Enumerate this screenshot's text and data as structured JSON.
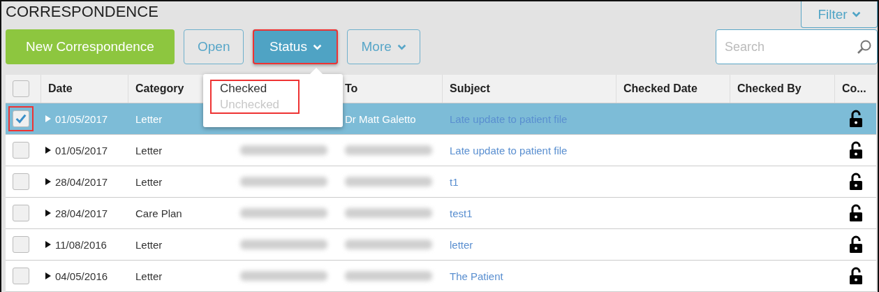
{
  "page": {
    "title": "CORRESPONDENCE"
  },
  "filter_button": {
    "label": "Filter"
  },
  "toolbar": [
    {
      "kind": "primary",
      "label": "New Correspondence",
      "highlighted": false
    },
    {
      "kind": "outline",
      "label": "Open",
      "highlighted": false
    },
    {
      "kind": "active",
      "label": "Status",
      "highlighted": true,
      "dropdown": true
    },
    {
      "kind": "outline",
      "label": "More",
      "highlighted": false,
      "dropdown": true
    }
  ],
  "search": {
    "placeholder": "Search"
  },
  "status_menu": {
    "highlighted": true,
    "items": [
      {
        "label": "Checked",
        "disabled": false
      },
      {
        "label": "Unchecked",
        "disabled": true
      }
    ]
  },
  "table": {
    "all_checked": false,
    "columns": [
      "Date",
      "Category",
      "",
      "To",
      "Subject",
      "Checked Date",
      "Checked By",
      "Co..."
    ],
    "rows": [
      {
        "selected": true,
        "checked": true,
        "highlighted": true,
        "date": "01/05/2017",
        "category": "Letter",
        "to": "Dr Matt Galetto",
        "subject": "Late update to patient file"
      },
      {
        "selected": false,
        "checked": false,
        "highlighted": false,
        "date": "01/05/2017",
        "category": "Letter",
        "from_redacted": true,
        "to_redacted": true,
        "subject": "Late update to patient file"
      },
      {
        "selected": false,
        "checked": false,
        "highlighted": false,
        "date": "28/04/2017",
        "category": "Letter",
        "from_redacted": true,
        "to_redacted": true,
        "subject": "t1"
      },
      {
        "selected": false,
        "checked": false,
        "highlighted": false,
        "date": "28/04/2017",
        "category": "Care Plan",
        "from_redacted": true,
        "to_redacted": true,
        "subject": "test1"
      },
      {
        "selected": false,
        "checked": false,
        "highlighted": false,
        "date": "11/08/2016",
        "category": "Letter",
        "from_redacted": true,
        "to_redacted": true,
        "subject": "letter"
      },
      {
        "selected": false,
        "checked": false,
        "highlighted": false,
        "date": "04/05/2016",
        "category": "Letter",
        "from_redacted": true,
        "to_redacted": true,
        "subject": "The Patient"
      }
    ]
  }
}
